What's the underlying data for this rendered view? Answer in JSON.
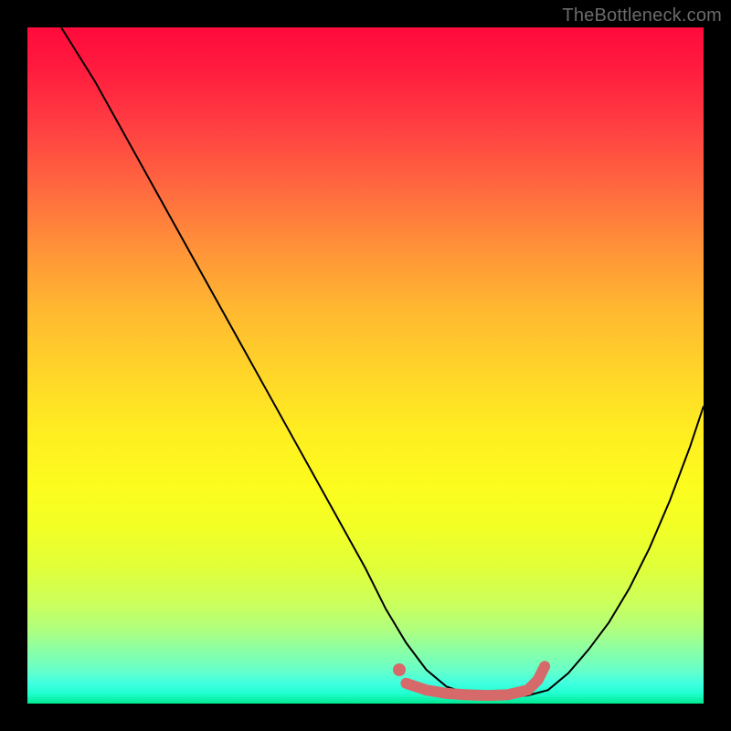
{
  "watermark": "TheBottleneck.com",
  "chart_data": {
    "type": "line",
    "title": "",
    "xlabel": "",
    "ylabel": "",
    "xlim": [
      0,
      100
    ],
    "ylim": [
      0,
      100
    ],
    "series": [
      {
        "name": "curve",
        "x": [
          5,
          10,
          15,
          20,
          25,
          30,
          35,
          40,
          45,
          50,
          53,
          56,
          59,
          62,
          65,
          68,
          71,
          74,
          77,
          80,
          83,
          86,
          89,
          92,
          95,
          98,
          100
        ],
        "y": [
          100,
          92,
          83,
          74,
          65,
          56,
          47,
          38,
          29,
          20,
          14,
          9,
          5,
          2.5,
          1.5,
          1,
          1,
          1.2,
          2,
          4.5,
          8,
          12,
          17,
          23,
          30,
          38,
          44
        ]
      },
      {
        "name": "highlight",
        "x": [
          56,
          59,
          62,
          65,
          68,
          71,
          74,
          75.5,
          76.5
        ],
        "y": [
          3,
          2,
          1.5,
          1.3,
          1.2,
          1.3,
          2,
          3.5,
          5.5
        ]
      },
      {
        "name": "highlight-dot",
        "x": [
          55
        ],
        "y": [
          5
        ]
      }
    ],
    "colors": {
      "curve": "#000000",
      "highlight": "#d66a6a"
    }
  }
}
